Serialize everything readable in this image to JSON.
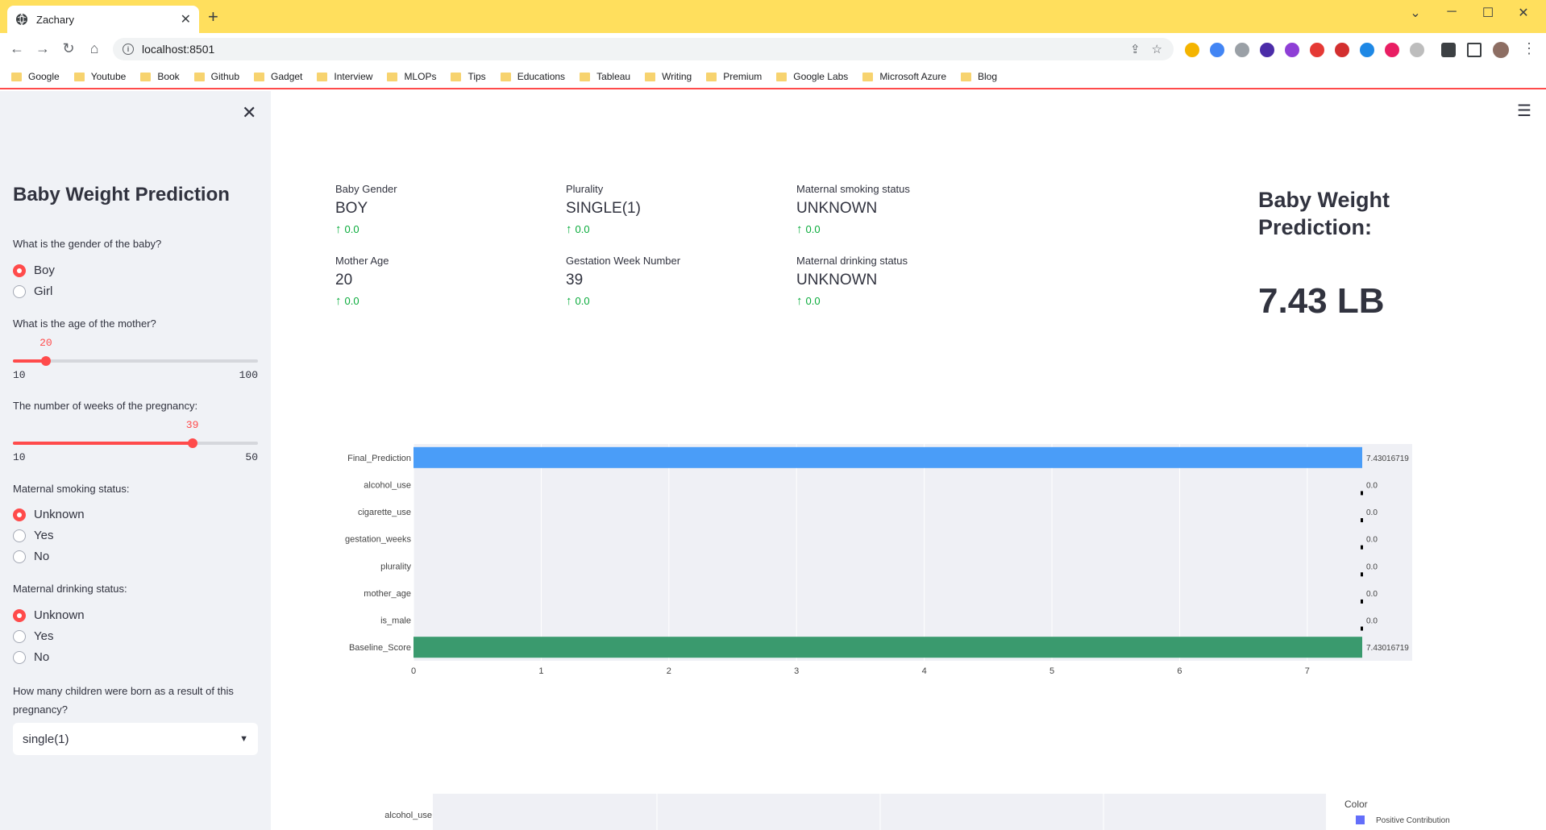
{
  "browser": {
    "tab_title": "Zachary",
    "url": "localhost:8501",
    "bookmarks": [
      "Google",
      "Youtube",
      "Book",
      "Github",
      "Gadget",
      "Interview",
      "MLOPs",
      "Tips",
      "Educations",
      "Tableau",
      "Writing",
      "Premium",
      "Google Labs",
      "Microsoft Azure",
      "Blog"
    ]
  },
  "sidebar": {
    "title": "Baby Weight Prediction",
    "gender_q": "What is the gender of the baby?",
    "gender_options": [
      "Boy",
      "Girl"
    ],
    "gender_selected": "Boy",
    "age_q": "What is the age of the mother?",
    "age_slider": {
      "value": "20",
      "min": "10",
      "max": "100"
    },
    "weeks_q": "The number of weeks of the pregnancy:",
    "weeks_slider": {
      "value": "39",
      "min": "10",
      "max": "50"
    },
    "smoking_q": "Maternal smoking status:",
    "smoking_options": [
      "Unknown",
      "Yes",
      "No"
    ],
    "smoking_selected": "Unknown",
    "drinking_q": "Maternal drinking status:",
    "drinking_options": [
      "Unknown",
      "Yes",
      "No"
    ],
    "drinking_selected": "Unknown",
    "plurality_q": "How many children were born as a result of this pregnancy?",
    "plurality_value": "single(1)"
  },
  "metrics": [
    {
      "label": "Baby Gender",
      "value": "BOY",
      "delta": "0.0"
    },
    {
      "label": "Plurality",
      "value": "SINGLE(1)",
      "delta": "0.0"
    },
    {
      "label": "Maternal smoking status",
      "value": "UNKNOWN",
      "delta": "0.0"
    },
    {
      "label": "Mother Age",
      "value": "20",
      "delta": "0.0"
    },
    {
      "label": "Gestation Week Number",
      "value": "39",
      "delta": "0.0"
    },
    {
      "label": "Maternal drinking status",
      "value": "UNKNOWN",
      "delta": "0.0"
    }
  ],
  "prediction": {
    "title": "Baby Weight Prediction:",
    "value": "7.43 LB"
  },
  "colors": {
    "accent": "#ff4b4b",
    "final_bar": "#4a9df8",
    "baseline_bar": "#3a9a6e",
    "plot_bg": "#eff0f5",
    "delta_green": "#09ab3b",
    "legend_swatch": "#636efa"
  },
  "chart_data": [
    {
      "type": "bar",
      "orientation": "horizontal",
      "categories": [
        "Final_Prediction",
        "alcohol_use",
        "cigarette_use",
        "gestation_weeks",
        "plurality",
        "mother_age",
        "is_male",
        "Baseline_Score"
      ],
      "values": [
        7.43016719,
        0.0,
        0.0,
        0.0,
        0.0,
        0.0,
        0.0,
        7.43016719
      ],
      "data_labels": [
        "7.43016719",
        "0.0",
        "0.0",
        "0.0",
        "0.0",
        "0.0",
        "0.0",
        "7.43016719"
      ],
      "xlim": [
        0,
        7.45
      ],
      "xticks": [
        0,
        1,
        2,
        3,
        4,
        5,
        6,
        7
      ]
    },
    {
      "type": "bar",
      "orientation": "horizontal",
      "categories": [
        "alcohol_use"
      ],
      "legend_title": "Color",
      "legend_items": [
        "Positive Contribution"
      ]
    }
  ]
}
